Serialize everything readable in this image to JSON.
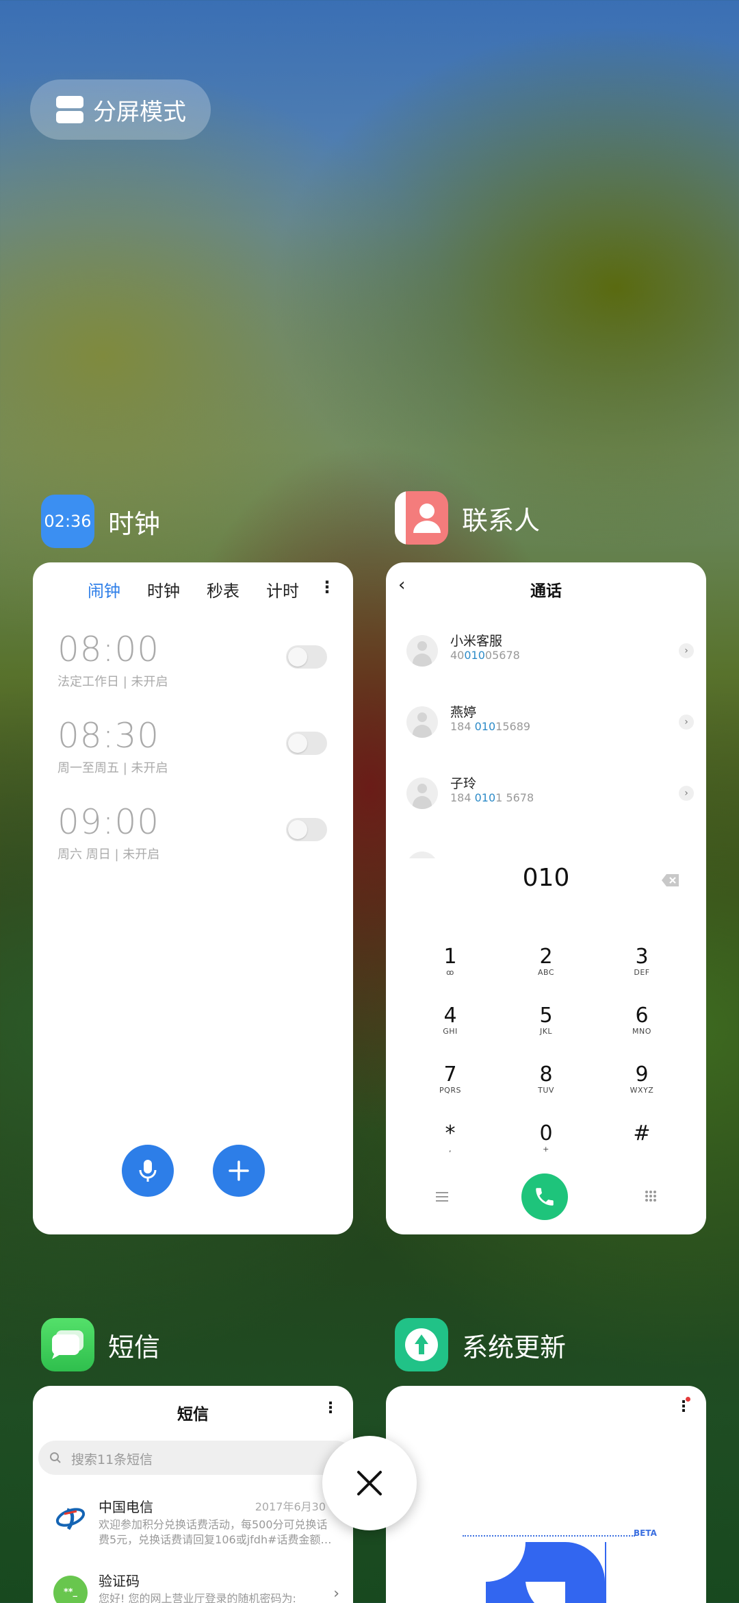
{
  "split_screen": {
    "label": "分屏模式"
  },
  "apps": {
    "clock": {
      "name": "时钟",
      "icon_time": "02:36",
      "tabs": [
        "闹钟",
        "时钟",
        "秒表",
        "计时"
      ],
      "active_tab": "闹钟",
      "alarms": [
        {
          "time": "08:00",
          "desc": "法定工作日 | 未开启",
          "enabled": false
        },
        {
          "time": "08:30",
          "desc": "周一至周五 | 未开启",
          "enabled": false
        },
        {
          "time": "09:00",
          "desc": "周六 周日 | 未开启",
          "enabled": false
        }
      ]
    },
    "contacts": {
      "name": "联系人",
      "header_title": "通话",
      "rows": [
        {
          "name": "小米客服",
          "num_pre": "40",
          "num_hl": "010",
          "num_post": "05678"
        },
        {
          "name": "燕婷",
          "num_pre": "184 ",
          "num_hl": "010",
          "num_post": "15689"
        },
        {
          "name": "子玲",
          "num_pre": "184 ",
          "num_hl": "010",
          "num_post": "1 5678"
        }
      ],
      "dial_input": "010",
      "keys": [
        {
          "d": "1",
          "l": "ꝏ"
        },
        {
          "d": "2",
          "l": "ABC"
        },
        {
          "d": "3",
          "l": "DEF"
        },
        {
          "d": "4",
          "l": "GHI"
        },
        {
          "d": "5",
          "l": "JKL"
        },
        {
          "d": "6",
          "l": "MNO"
        },
        {
          "d": "7",
          "l": "PQRS"
        },
        {
          "d": "8",
          "l": "TUV"
        },
        {
          "d": "9",
          "l": "WXYZ"
        },
        {
          "d": "*",
          "l": ","
        },
        {
          "d": "0",
          "l": "+"
        },
        {
          "d": "#",
          "l": ""
        }
      ]
    },
    "messages": {
      "name": "短信",
      "header_title": "短信",
      "search_placeholder": "搜索11条短信",
      "threads": [
        {
          "sender": "中国电信",
          "date": "2017年6月30",
          "preview_1": "欢迎参加积分兑换话费活动，每500分可兑换话",
          "preview_2": "费5元，兑换话费请回复106或jfdh#话费金额…"
        },
        {
          "sender": "验证码",
          "date": "",
          "preview_1": "您好! 您的网上营业厅登录的随机密码为:",
          "preview_2": ""
        }
      ]
    },
    "system_update": {
      "name": "系统更新",
      "badge": "BETA"
    }
  },
  "colors": {
    "accent": "#2d7ee8",
    "call_green": "#1ec47b",
    "contacts_red": "#f47c7c",
    "sms_green": "#3ed05f",
    "update_green": "#21c287"
  }
}
